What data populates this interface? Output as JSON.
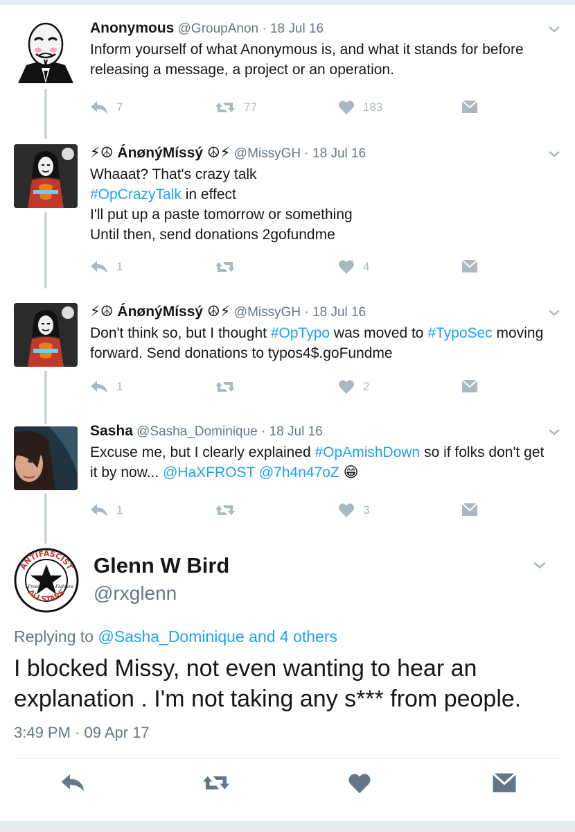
{
  "tweets": [
    {
      "name": "Anonymous",
      "handle": "@GroupAnon",
      "date": "· 18 Jul 16",
      "avatar_icon": "guy-fawkes-mask",
      "text_parts": [
        {
          "t": "Inform yourself of what Anonymous is, and what it stands for before releasing a message, a project or an operation.",
          "link": false
        }
      ],
      "replies": "7",
      "retweets": "77",
      "likes": "183"
    },
    {
      "name": "⚡☮ ÁnønýMíssý ☮⚡",
      "handle": "@MissyGH",
      "date": "· 18 Jul 16",
      "avatar_icon": "masked-woman",
      "text_parts": [
        {
          "t": "Whaaat? That's crazy talk",
          "link": false
        },
        {
          "br": true
        },
        {
          "t": "#OpCrazyTalk",
          "link": true
        },
        {
          "t": " in effect",
          "link": false
        },
        {
          "br": true
        },
        {
          "t": "I'll put up a paste tomorrow or something",
          "link": false
        },
        {
          "br": true
        },
        {
          "t": "Until then, send donations 2gofundme",
          "link": false
        }
      ],
      "replies": "1",
      "retweets": "",
      "likes": "4"
    },
    {
      "name": "⚡☮ ÁnønýMíssý ☮⚡",
      "handle": "@MissyGH",
      "date": "· 18 Jul 16",
      "avatar_icon": "masked-woman",
      "text_parts": [
        {
          "t": "Don't think so, but I thought ",
          "link": false
        },
        {
          "t": "#OpTypo",
          "link": true
        },
        {
          "t": " was moved to ",
          "link": false
        },
        {
          "t": "#TypoSec",
          "link": true
        },
        {
          "t": " moving forward. Send donations to typos4$.goFundme",
          "link": false
        }
      ],
      "replies": "1",
      "retweets": "",
      "likes": "2"
    },
    {
      "name": "Sasha",
      "handle": "@Sasha_Dominique",
      "date": "· 18 Jul 16",
      "avatar_icon": "woman-portrait",
      "text_parts": [
        {
          "t": "Excuse me, but I clearly explained ",
          "link": false
        },
        {
          "t": "#OpAmishDown",
          "link": true
        },
        {
          "t": " so if folks don't get it by now... ",
          "link": false
        },
        {
          "t": "@HaXFROST",
          "link": true
        },
        {
          "t": " ",
          "link": false
        },
        {
          "t": "@7h4n47oZ",
          "link": true
        },
        {
          "t": " 😁",
          "link": false
        }
      ],
      "replies": "1",
      "retweets": "",
      "likes": "3"
    }
  ],
  "main_tweet": {
    "name": "Glenn W Bird",
    "handle": "@rxglenn",
    "avatar_icon": "antifascist-allstars-logo",
    "avatar_text_top": "ANTIFASCIST",
    "avatar_text_bottom": "ALLSTARS",
    "avatar_text_left": "Freedom",
    "avatar_text_right": "Fighters",
    "replying_prefix": "Replying to ",
    "replying_link": "@Sasha_Dominique and 4 others",
    "text": "I blocked Missy, not even wanting to hear an explanation . I'm not taking any s*** from people.",
    "timestamp": "3:49 PM · 09 Apr 17"
  },
  "colors": {
    "link": "#1da1f2",
    "secondary_text": "#657786",
    "action_icon": "#aab8c2",
    "main_action_icon": "#657786",
    "thread_line": "#ccd6dd"
  },
  "icons": [
    "reply-icon",
    "retweet-icon",
    "like-icon",
    "dm-icon",
    "chevron-down-icon"
  ]
}
